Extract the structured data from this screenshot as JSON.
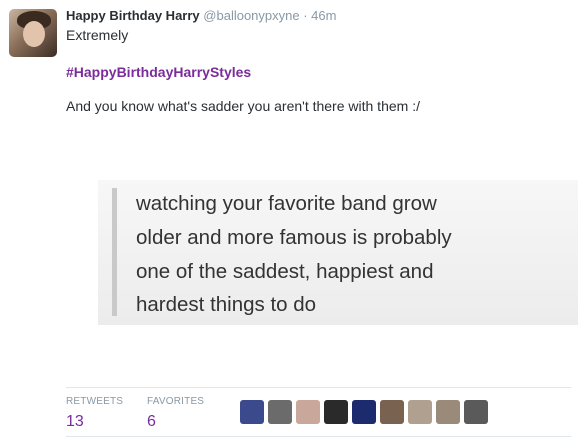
{
  "tweet": {
    "display_name": "Happy Birthday Harry",
    "handle": "@balloonypxyne",
    "separator": " · ",
    "time": "46m",
    "text_line1": "Extremely",
    "hashtag": "#HappyBirthdayHarryStyles",
    "text_line3": "And you know what's sadder you aren't there with them :/"
  },
  "media": {
    "lines": [
      "watching your favorite band grow",
      "older and more famous is probably",
      "one of the saddest, happiest and",
      "hardest things to do"
    ]
  },
  "stats": {
    "retweets_label": "RETWEETS",
    "retweets_count": "13",
    "favorites_label": "FAVORITES",
    "favorites_count": "6"
  },
  "favoriters": [
    {
      "color": "#3b4a8c"
    },
    {
      "color": "#6b6b6b"
    },
    {
      "color": "#c9a79a"
    },
    {
      "color": "#2a2a2a"
    },
    {
      "color": "#1c2a6e"
    },
    {
      "color": "#7a6250"
    },
    {
      "color": "#b0a090"
    },
    {
      "color": "#9a8a7a"
    },
    {
      "color": "#5a5a5a"
    }
  ],
  "colors": {
    "accent": "#7b2c9b",
    "muted": "#8899a6",
    "text": "#292f33"
  }
}
